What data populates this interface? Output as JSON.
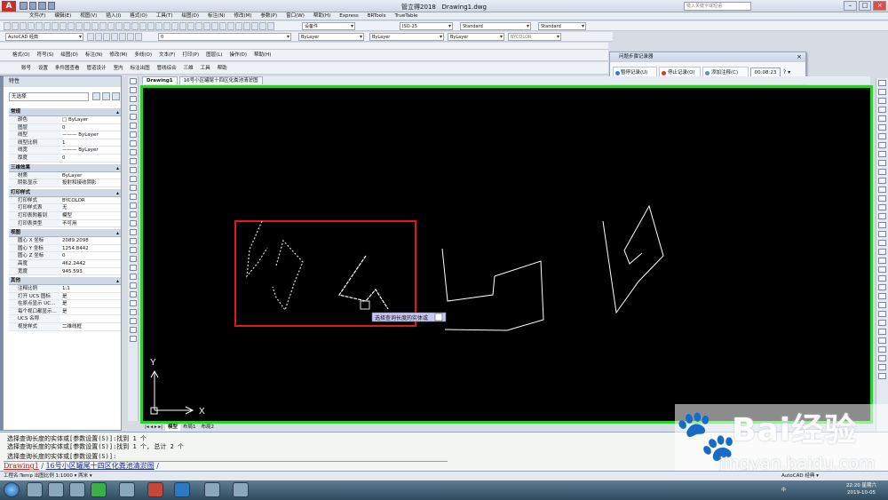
{
  "titlebar": {
    "title": "管立得2018",
    "file": "Drawing1.dwg",
    "search_placeholder": "键入关键字或短语"
  },
  "menubar": {
    "items": [
      "文件(F)",
      "编辑(E)",
      "视图(V)",
      "插入(I)",
      "格式(O)",
      "工具(T)",
      "绘图(D)",
      "标注(N)",
      "修改(M)",
      "参数(P)",
      "窗口(W)",
      "帮助(H)",
      "Express",
      "BRTools",
      "TrueTable"
    ]
  },
  "toolbar": {
    "workspace": "AutoCAD 经典",
    "layer": "0",
    "textstyle": "设备件",
    "dimstyle": "ISO-25",
    "tablestyle": "Standard",
    "mlstyle": "Standard",
    "color": "ByLayer",
    "linetype": "ByLayer",
    "lineweight": "ByLayer",
    "plotstyle": "BYCOLOR"
  },
  "menu2": {
    "items": [
      "格式(O)",
      "符号(S)",
      "绘图(D)",
      "标注(N)",
      "修改(M)",
      "多线(O)",
      "文本(F)",
      "打印(P)",
      "图层(L)",
      "操作(D)",
      "帮助(H)"
    ]
  },
  "menu3": {
    "items": [
      "账号",
      "设置",
      "条件图查看",
      "管道设计",
      "室内",
      "标注出图",
      "管线综合",
      "三维",
      "工具",
      "帮助"
    ]
  },
  "recorder": {
    "title": "问题步骤记录器",
    "pause": "暂停记录(U)",
    "stop": "停止记录(O)",
    "note": "添加注释(C)",
    "timer": "00:08:23"
  },
  "properties": {
    "title": "特性",
    "selection": "无选择",
    "sections": [
      {
        "name": "常规",
        "rows": [
          [
            "颜色",
            "□ ByLayer"
          ],
          [
            "图层",
            "0"
          ],
          [
            "线型",
            "——— ByLayer"
          ],
          [
            "线型比例",
            "1"
          ],
          [
            "线宽",
            "——— ByLayer"
          ],
          [
            "厚度",
            "0"
          ]
        ]
      },
      {
        "name": "三维效果",
        "rows": [
          [
            "材质",
            "ByLayer"
          ],
          [
            "阴影显示",
            "投射和接收阴影"
          ]
        ]
      },
      {
        "name": "打印样式",
        "rows": [
          [
            "打印样式",
            "BYCOLOR"
          ],
          [
            "打印样式表",
            "无"
          ],
          [
            "打印表附着到",
            "模型"
          ],
          [
            "打印表类型",
            "不可用"
          ]
        ]
      },
      {
        "name": "视图",
        "rows": [
          [
            "圆心 X 坐标",
            "2089.2098"
          ],
          [
            "圆心 Y 坐标",
            "1254.8442"
          ],
          [
            "圆心 Z 坐标",
            "0"
          ],
          [
            "高度",
            "462.2442"
          ],
          [
            "宽度",
            "945.593"
          ]
        ]
      },
      {
        "name": "其他",
        "rows": [
          [
            "注释比例",
            "1:1"
          ],
          [
            "打开 UCS 图标",
            "是"
          ],
          [
            "在原点显示 UC...",
            "是"
          ],
          [
            "每个视口都显示...",
            "是"
          ],
          [
            "UCS 名称",
            ""
          ],
          [
            "视觉样式",
            "二维线框"
          ]
        ]
      }
    ]
  },
  "filetabs": [
    "Drawing1",
    "16号小区罐尾十四区化粪池清淤图"
  ],
  "canvas": {
    "tooltip": "选择查询长度的实体或",
    "axis_x": "X",
    "axis_y": "Y"
  },
  "layouttabs": [
    "模型",
    "布局1",
    "布局2"
  ],
  "cmd": {
    "line1": "选择查询长度的实体或[参数设置(S)]:找到 1 个",
    "line2": "选择查询长度的实体或[参数设置(S)]:找到 1 个, 总计 2 个",
    "line3": "选择查询长度的实体或[参数设置(S)]:",
    "tab1": "Drawing1",
    "tab2": "16号小区罐尾十四区化粪池清淤图"
  },
  "status": {
    "left": "工程名:Temp 出图比例 1:1000 ▾ 两米 ▾",
    "right": "AutoCAD 经典 ▾"
  },
  "watermark": {
    "brand": "Bai",
    "brand2": "经验",
    "url": "jingyan.baidu.com"
  },
  "taskbar": {
    "time": "22:20 星期六",
    "date": "2019-10-05",
    "ime": "中"
  },
  "colors": {
    "canvas_border": "#2bd12b",
    "selection_box": "#e01818",
    "tooltip_bg": "#c9c9f0"
  }
}
